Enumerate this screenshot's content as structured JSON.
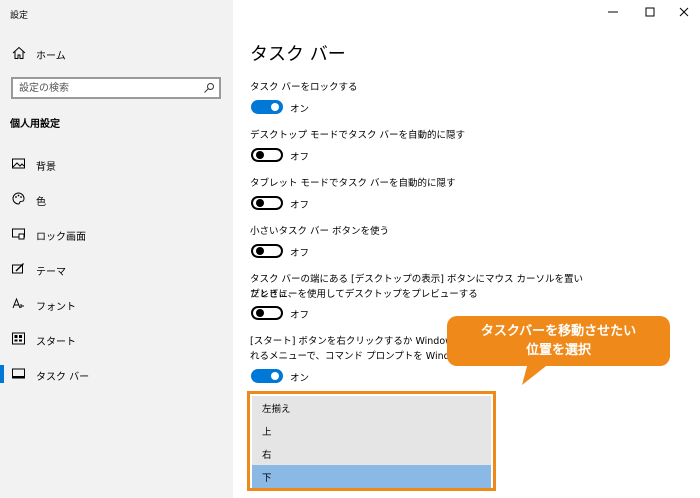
{
  "window": {
    "title": "設定"
  },
  "sidebar": {
    "home_label": "ホーム",
    "search_placeholder": "設定の検索",
    "section_title": "個人用設定",
    "items": [
      {
        "label": "背景",
        "icon": "picture-icon"
      },
      {
        "label": "色",
        "icon": "palette-icon"
      },
      {
        "label": "ロック画面",
        "icon": "lock-screen-icon"
      },
      {
        "label": "テーマ",
        "icon": "theme-icon"
      },
      {
        "label": "フォント",
        "icon": "font-icon"
      },
      {
        "label": "スタート",
        "icon": "start-icon"
      },
      {
        "label": "タスク バー",
        "icon": "taskbar-icon",
        "active": true
      }
    ]
  },
  "main": {
    "title": "タスク バー",
    "settings": [
      {
        "label": "タスク バーをロックする",
        "state": "オン",
        "on": true
      },
      {
        "label": "デスクトップ モードでタスク バーを自動的に隠す",
        "state": "オフ",
        "on": false
      },
      {
        "label": "タブレット モードでタスク バーを自動的に隠す",
        "state": "オフ",
        "on": false
      },
      {
        "label": "小さいタスク バー ボタンを使う",
        "state": "オフ",
        "on": false
      },
      {
        "label_line1": "タスク バーの端にある [デスクトップの表示] ボタンにマウス カーソルを置いたときに、",
        "label_line2": "プレビューを使用してデスクトップをプレビューする",
        "state": "オフ",
        "on": false
      },
      {
        "label_line1": "[スタート] ボタンを右クリックするか Windows キー",
        "label_line2": "れるメニューで、コマンド プロンプトを Windows Po",
        "state": "オン",
        "on": true
      }
    ],
    "dropdown_options": [
      "左揃え",
      "上",
      "右",
      "下"
    ],
    "dropdown_selected": "下"
  },
  "annotation": {
    "line1": "タスクバーを移動させたい",
    "line2": "位置を選択"
  },
  "colors": {
    "accent": "#0078d7",
    "callout": "#ef8a1a",
    "selected": "#8ab9e6",
    "sidebar_bg": "#f2f2f2"
  }
}
